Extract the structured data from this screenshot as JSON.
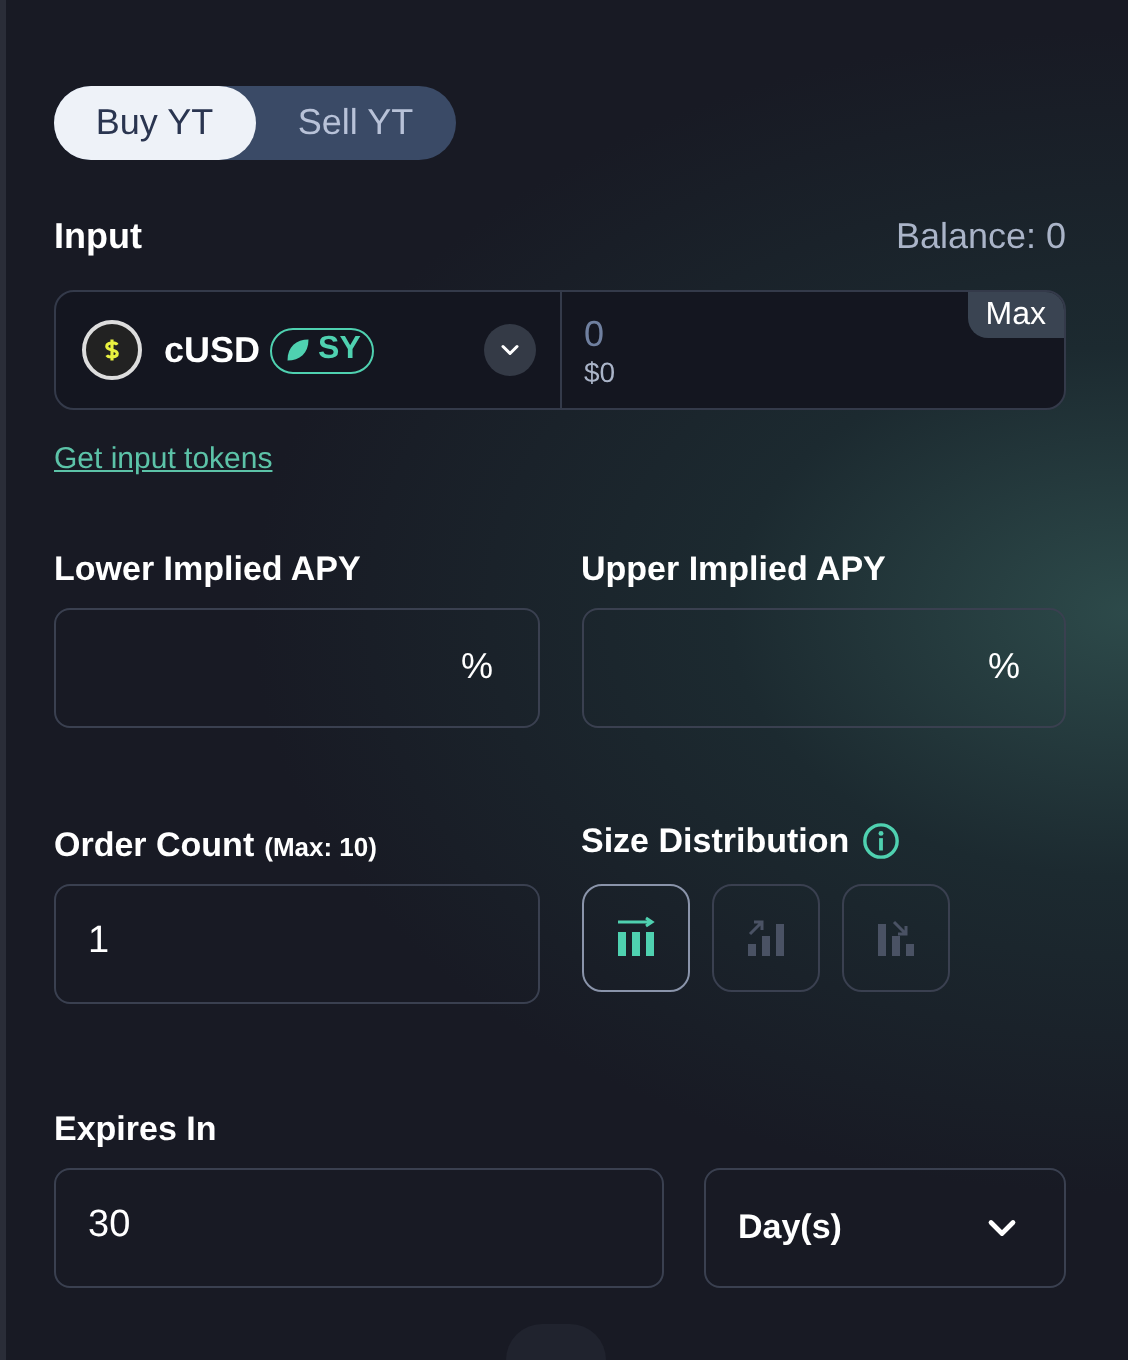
{
  "tabs": [
    {
      "label": "Buy YT",
      "selected": true
    },
    {
      "label": "Sell YT",
      "selected": false
    }
  ],
  "input": {
    "label": "Input",
    "balance": "Balance: 0",
    "token": "cUSD",
    "token_tag": "SY",
    "amount": "0",
    "amount_usd": "$0",
    "max_button": "Max"
  },
  "get_tokens_link": "Get input tokens",
  "apy": [
    {
      "label": "Lower Implied APY",
      "unit": "%"
    },
    {
      "label": "Upper Implied APY",
      "unit": "%"
    }
  ],
  "order_count": {
    "label": "Order Count",
    "hint": "(Max: 10)",
    "value": "1"
  },
  "size_distribution": {
    "label": "Size Distribution",
    "options": [
      {
        "kind": "flat",
        "selected": true
      },
      {
        "kind": "increasing",
        "selected": false
      },
      {
        "kind": "decreasing",
        "selected": false
      }
    ]
  },
  "expires": {
    "label": "Expires In",
    "value": "30",
    "unit": "Day(s)"
  }
}
